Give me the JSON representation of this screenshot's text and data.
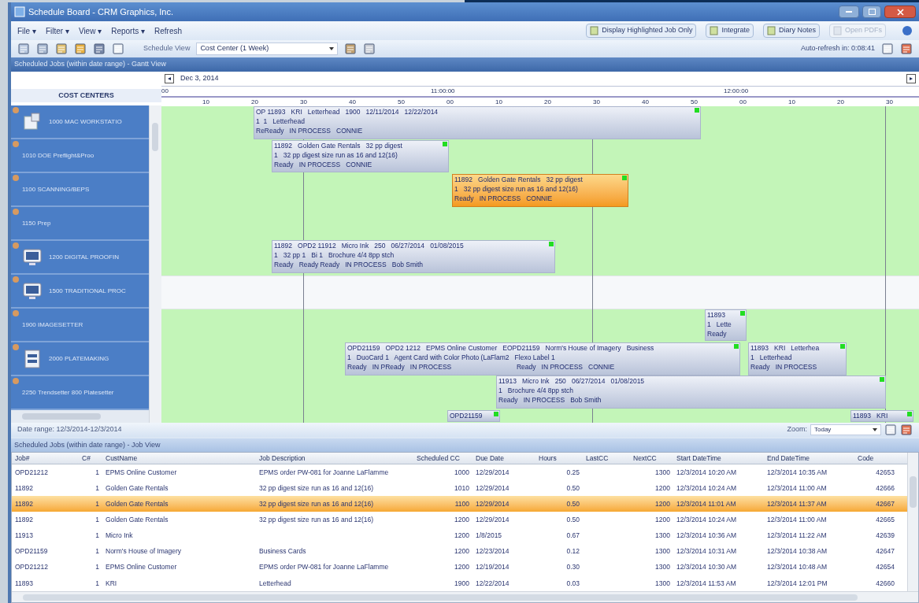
{
  "window": {
    "title": "Schedule Board - CRM Graphics, Inc."
  },
  "menu": [
    "File ▾",
    "Filter ▾",
    "View ▾",
    "Reports ▾",
    "Refresh"
  ],
  "toolbar_right": [
    {
      "label": "Display Highlighted Job Only",
      "disabled": false
    },
    {
      "label": "Integrate",
      "disabled": false
    },
    {
      "label": "Diary Notes",
      "disabled": false
    },
    {
      "label": "Open PDFs",
      "disabled": true
    }
  ],
  "schedule_view": {
    "label": "Schedule View",
    "value": "Cost Center (1 Week)"
  },
  "auto_refresh": "Auto-refresh in: 0:08:41",
  "gantt": {
    "header": "Scheduled Jobs (within date range) - Gantt View",
    "date": "Dec 3, 2014",
    "prev": "◂",
    "next": "▸",
    "cost_centers_title": "COST CENTERS",
    "major_ticks": [
      "00",
      "11:00:00",
      "12:00:00"
    ],
    "minor_ticks": [
      "10",
      "20",
      "30",
      "40",
      "50",
      "00",
      "10",
      "20",
      "30",
      "40",
      "50",
      "00",
      "10",
      "20",
      "30"
    ],
    "cost_centers": [
      {
        "name": "1000 MAC WORKSTATIO",
        "kind": "device",
        "available": true
      },
      {
        "name": "1010 DOE Preflight&Proo",
        "kind": "plain",
        "available": true
      },
      {
        "name": "1100 SCANNING/BEPS",
        "kind": "plain",
        "available": true
      },
      {
        "name": "1150 Prep",
        "kind": "plain",
        "available": true
      },
      {
        "name": "1200 DIGITAL PROOFIN",
        "kind": "monitor",
        "available": true
      },
      {
        "name": "1500 TRADITIONAL PROC",
        "kind": "monitor",
        "available": false
      },
      {
        "name": "1900 IMAGESETTER",
        "kind": "plain",
        "available": true
      },
      {
        "name": "2000 PLATEMAKING",
        "kind": "printer",
        "available": true
      },
      {
        "name": "2250 Trendsetter 800 Platesetter",
        "kind": "plain",
        "available": true
      }
    ],
    "bars": [
      {
        "lines": [
          "OP 11893   KRI   Letterhead   1900   12/11/2014   12/22/2014",
          "1  1   Letterhead",
          "ReReady   IN PROCESS   CONNIE"
        ],
        "highlighted": false
      },
      {
        "lines": [
          "11892   Golden Gate Rentals   32 pp digest",
          "1   32 pp digest size run as 16 and 12(16)",
          "Ready   IN PROCESS   CONNIE"
        ],
        "highlighted": false
      },
      {
        "lines": [
          "11892   Golden Gate Rentals   32 pp digest",
          "1   32 pp digest size run as 16 and 12(16)",
          "Ready   IN PROCESS   CONNIE"
        ],
        "highlighted": true
      },
      {
        "lines": [
          "11892   OPD2 11912   Micro Ink   250   06/27/2014   01/08/2015",
          "1   32 pp 1   Bi 1   Brochure 4/4 8pp stch",
          "Ready   Ready Ready   IN PROCESS   Bob Smith"
        ],
        "highlighted": false
      },
      {
        "lines": [
          "11893",
          "1   Lette",
          "Ready"
        ],
        "highlighted": false
      },
      {
        "lines": [
          "OPD21159   OPD2 1212   EPMS Online Customer   EOPD21159   Norm's House of Imagery   Business",
          "1   DuoCard 1   Agent Card with Color Photo (LaFlam2   Flexo Label 1",
          "Ready   IN PReady   IN PROCESS                                   Ready   IN PROCESS   CONNIE"
        ],
        "highlighted": false
      },
      {
        "lines": [
          "11893   KRI   Letterhea",
          "1   Letterhead",
          "Ready   IN PROCESS"
        ],
        "highlighted": false
      },
      {
        "lines": [
          "11913   Micro Ink   250   06/27/2014   01/08/2015",
          "1   Brochure 4/4 8pp stch",
          "Ready   IN PROCESS   Bob Smith"
        ],
        "highlighted": false
      },
      {
        "lines": [
          "OPD21159"
        ],
        "highlighted": false
      },
      {
        "lines": [
          "11893   KRI"
        ],
        "highlighted": false
      }
    ],
    "date_range": "Date range: 12/3/2014-12/3/2014",
    "zoom": {
      "label": "Zoom:",
      "value": "Today"
    }
  },
  "job_view": {
    "header": "Scheduled Jobs (within date range) - Job View",
    "columns": [
      "Job#",
      "C#",
      "CustName",
      "Job Description",
      "Scheduled CC",
      "Due Date",
      "Hours",
      "LastCC",
      "NextCC",
      "Start DateTime",
      "End DateTime",
      "Code"
    ],
    "rows": [
      {
        "selected": false,
        "cells": [
          "OPD21212",
          "1",
          "EPMS Online Customer",
          "EPMS order PW-081 for Joanne LaFlamme",
          "1000",
          "12/29/2014",
          "0.25",
          "",
          "1300",
          "12/3/2014 10:20 AM",
          "12/3/2014 10:35 AM",
          "42653"
        ]
      },
      {
        "selected": false,
        "cells": [
          "11892",
          "1",
          "Golden Gate Rentals",
          "32 pp digest size run as 16 and 12(16)",
          "1010",
          "12/29/2014",
          "0.50",
          "",
          "1200",
          "12/3/2014 10:24 AM",
          "12/3/2014 11:00 AM",
          "42666"
        ]
      },
      {
        "selected": true,
        "cells": [
          "11892",
          "1",
          "Golden Gate Rentals",
          "32 pp digest size run as 16 and 12(16)",
          "1100",
          "12/29/2014",
          "0.50",
          "",
          "1200",
          "12/3/2014 11:01 AM",
          "12/3/2014 11:37 AM",
          "42667"
        ]
      },
      {
        "selected": false,
        "cells": [
          "11892",
          "1",
          "Golden Gate Rentals",
          "32 pp digest size run as 16 and 12(16)",
          "1200",
          "12/29/2014",
          "0.50",
          "",
          "1200",
          "12/3/2014 10:24 AM",
          "12/3/2014 11:00 AM",
          "42665"
        ]
      },
      {
        "selected": false,
        "cells": [
          "11913",
          "1",
          "Micro Ink",
          "",
          "1200",
          "1/8/2015",
          "0.67",
          "",
          "1300",
          "12/3/2014 10:36 AM",
          "12/3/2014 11:22 AM",
          "42639"
        ]
      },
      {
        "selected": false,
        "cells": [
          "OPD21159",
          "1",
          "Norm's House of Imagery",
          "Business Cards",
          "1200",
          "12/23/2014",
          "0.12",
          "",
          "1300",
          "12/3/2014 10:31 AM",
          "12/3/2014 10:38 AM",
          "42647"
        ]
      },
      {
        "selected": false,
        "cells": [
          "OPD21212",
          "1",
          "EPMS Online Customer",
          "EPMS order PW-081 for Joanne LaFlamme",
          "1200",
          "12/19/2014",
          "0.30",
          "",
          "1300",
          "12/3/2014 10:30 AM",
          "12/3/2014 10:48 AM",
          "42654"
        ]
      },
      {
        "selected": false,
        "cells": [
          "11893",
          "1",
          "KRI",
          "Letterhead",
          "1900",
          "12/22/2014",
          "0.03",
          "",
          "1300",
          "12/3/2014 11:53 AM",
          "12/3/2014 12:01 PM",
          "42660"
        ]
      }
    ]
  }
}
